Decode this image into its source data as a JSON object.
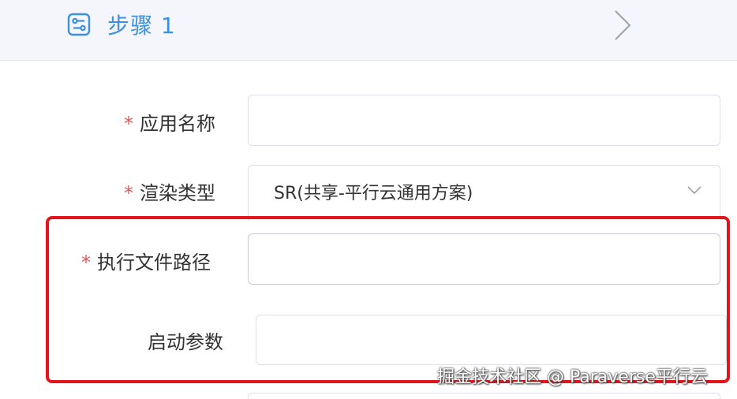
{
  "header": {
    "title": "步骤 1",
    "icon": "steps-icon",
    "expand_icon": "chevron-right-icon"
  },
  "form": {
    "app_name": {
      "required_mark": "*",
      "label": "应用名称",
      "value": ""
    },
    "render_type": {
      "required_mark": "*",
      "label": "渲染类型",
      "selected": "SR(共享-平行云通用方案)",
      "icon": "chevron-down-icon"
    },
    "exec_path": {
      "required_mark": "*",
      "label": "执行文件路径",
      "value": ""
    },
    "launch_params": {
      "label": "启动参数",
      "value": ""
    }
  },
  "watermark": "掘金技术社区 @ Paraverse平行云",
  "colors": {
    "accent": "#3d8fe3",
    "required": "#e05858",
    "highlight": "#e2141c",
    "header_bg": "#f4f6fb"
  }
}
